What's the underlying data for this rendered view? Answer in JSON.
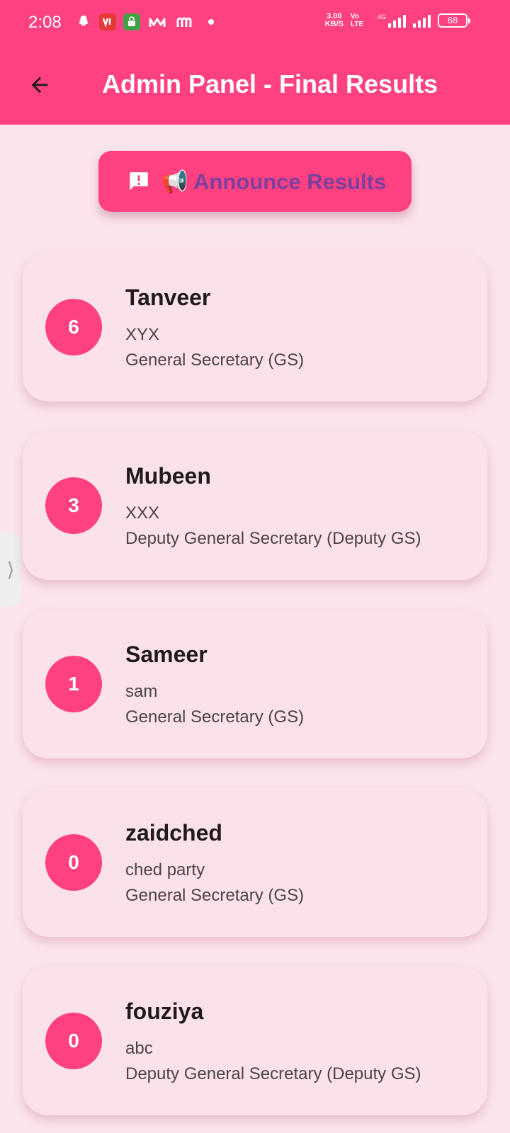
{
  "status_bar": {
    "time": "2:08",
    "speed_value": "3.00",
    "speed_unit": "KB/S",
    "volte_label": "Vo LTE",
    "network_label": "4G",
    "battery": "68",
    "left_icons": [
      "snapchat-icon",
      "vi-app-icon",
      "shopping-icon",
      "m-app-icon",
      "m-app-icon"
    ]
  },
  "app_bar": {
    "title": "Admin Panel - Final Results",
    "background_color": "#ff4081"
  },
  "announce_button": {
    "label": "📢 Announce Results",
    "icon": "alert-message-icon",
    "text_color": "#7b3f9e"
  },
  "results": [
    {
      "votes": "6",
      "name": "Tanveer",
      "party": "XYX",
      "position": "General Secretary (GS)"
    },
    {
      "votes": "3",
      "name": "Mubeen",
      "party": "XXX",
      "position": "Deputy General Secretary (Deputy GS)"
    },
    {
      "votes": "1",
      "name": "Sameer",
      "party": "sam",
      "position": "General Secretary (GS)"
    },
    {
      "votes": "0",
      "name": "zaidched",
      "party": "ched party",
      "position": "General Secretary (GS)"
    },
    {
      "votes": "0",
      "name": "fouziya",
      "party": "abc",
      "position": "Deputy General Secretary (Deputy GS)"
    }
  ],
  "colors": {
    "accent": "#ff4081",
    "background": "#fce4ec",
    "card": "#fbe2ea"
  }
}
